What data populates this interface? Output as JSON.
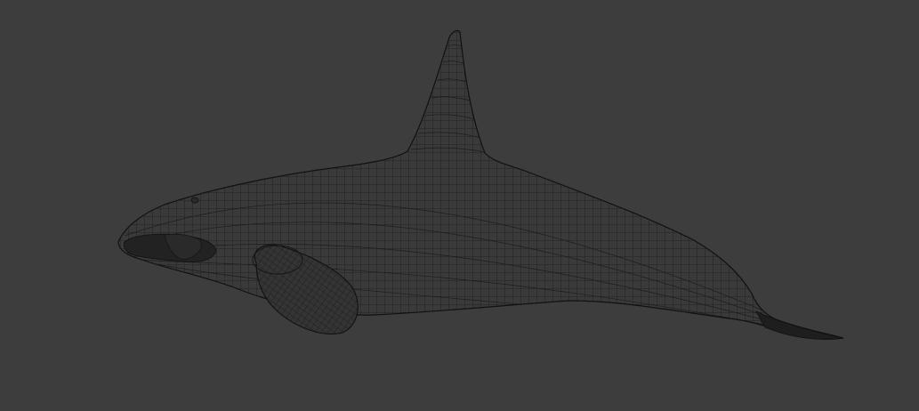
{
  "viewport": {
    "background_color": "#3d3d3d",
    "display_mode": "wireframe"
  },
  "model": {
    "subject": "orca-wireframe-mesh",
    "mesh_fill_color": "#3a3a3a",
    "wire_color": "#1c1c1c",
    "outline_color": "#111111",
    "eyepatch_color": "#222222"
  }
}
